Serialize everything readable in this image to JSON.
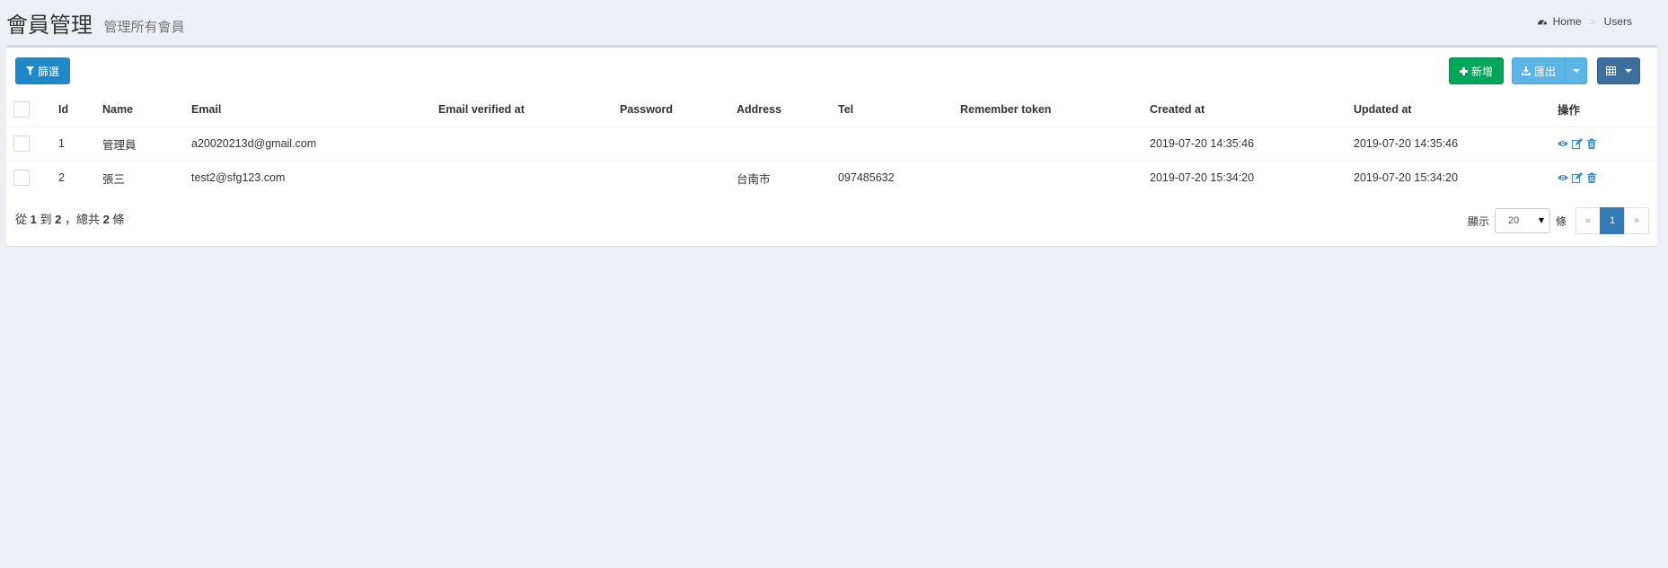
{
  "header": {
    "title": "會員管理",
    "subtitle": "管理所有會員",
    "breadcrumb": [
      "Home",
      "Users"
    ]
  },
  "toolbar": {
    "filter_label": "篩選",
    "new_label": "新增",
    "export_label": "匯出"
  },
  "table": {
    "columns": [
      "Id",
      "Name",
      "Email",
      "Email verified at",
      "Password",
      "Address",
      "Tel",
      "Remember token",
      "Created at",
      "Updated at",
      "操作"
    ],
    "rows": [
      {
        "id": "1",
        "name": "管理員",
        "email": "a20020213d@gmail.com",
        "email_verified_at": "",
        "password": "",
        "address": "",
        "tel": "",
        "remember_token": "",
        "created_at": "2019-07-20 14:35:46",
        "updated_at": "2019-07-20 14:35:46"
      },
      {
        "id": "2",
        "name": "張三",
        "email": "test2@sfg123.com",
        "email_verified_at": "",
        "password": "",
        "address": "台南市",
        "tel": "097485632",
        "remember_token": "",
        "created_at": "2019-07-20 15:34:20",
        "updated_at": "2019-07-20 15:34:20"
      }
    ]
  },
  "footer": {
    "from_prefix": "從",
    "from": "1",
    "to_word": "到",
    "to": "2",
    "total_prefix": "，總共",
    "total": "2",
    "total_suffix": "條",
    "show_label": "顯示",
    "per_page": "20",
    "per_page_suffix": "條",
    "prev": "«",
    "current_page": "1",
    "next": "»"
  },
  "colors": {
    "background": "#ecf0f5",
    "primary": "#1e88c8",
    "success": "#00a65a",
    "info": "#5bb6e6",
    "columns_btn": "#3c6e9e",
    "pager_active": "#337ab7",
    "action_icon": "#3c8dbc"
  },
  "icons": {
    "breadcrumb_home": "dashboard-icon",
    "filter": "filter-icon",
    "new": "plus-icon",
    "export": "download-icon",
    "columns": "table-icon",
    "row_view": "eye-icon",
    "row_edit": "edit-icon",
    "row_delete": "trash-icon"
  }
}
